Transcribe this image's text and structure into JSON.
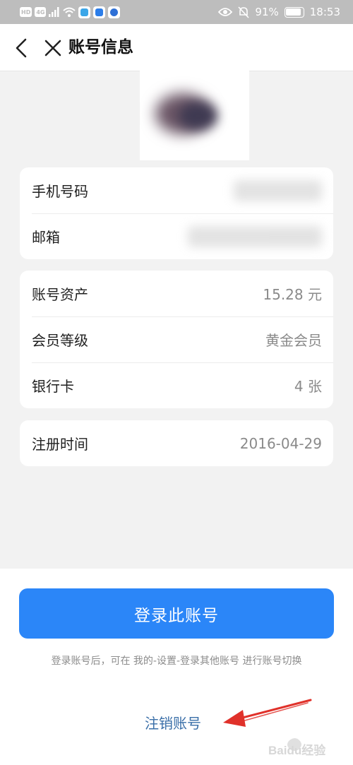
{
  "status_bar": {
    "left_chip_hd": "HD",
    "left_chip_4g": "4G",
    "battery": "91%",
    "time": "18:53"
  },
  "nav": {
    "title": "账号信息"
  },
  "contact_card": {
    "rows": [
      {
        "label": "手机号码"
      },
      {
        "label": "邮箱"
      }
    ]
  },
  "asset_card": {
    "rows": [
      {
        "label": "账号资产",
        "value": "15.28 元"
      },
      {
        "label": "会员等级",
        "value": "黄金会员"
      },
      {
        "label": "银行卡",
        "value": "4 张"
      }
    ]
  },
  "register_card": {
    "rows": [
      {
        "label": "注册时间",
        "value": "2016-04-29"
      }
    ]
  },
  "bottom": {
    "login_button": "登录此账号",
    "hint": "登录账号后，可在 我的-设置-登录其他账号 进行账号切换",
    "cancel_link": "注销账号"
  },
  "watermark": {
    "text": "Baidu经验"
  },
  "colors": {
    "primary": "#2b86f8",
    "link": "#3a6fa8",
    "annotation_arrow": "#e0312a"
  },
  "icons": [
    "back-icon",
    "close-icon",
    "eye-icon",
    "mute-bell-icon",
    "wifi-icon",
    "signal-icon"
  ]
}
